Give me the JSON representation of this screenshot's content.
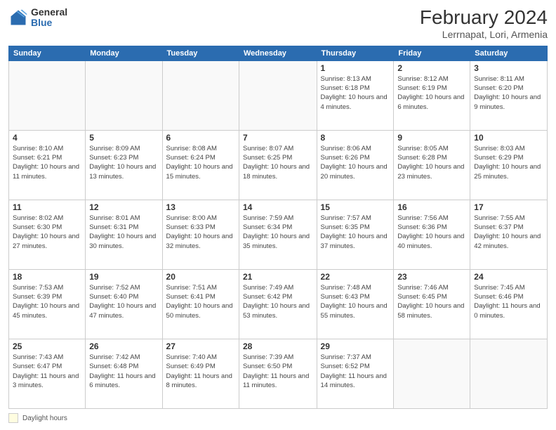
{
  "header": {
    "logo_general": "General",
    "logo_blue": "Blue",
    "title": "February 2024",
    "subtitle": "Lerrnapat, Lori, Armenia"
  },
  "footer": {
    "daylight_label": "Daylight hours"
  },
  "days_of_week": [
    "Sunday",
    "Monday",
    "Tuesday",
    "Wednesday",
    "Thursday",
    "Friday",
    "Saturday"
  ],
  "weeks": [
    [
      {
        "num": "",
        "info": ""
      },
      {
        "num": "",
        "info": ""
      },
      {
        "num": "",
        "info": ""
      },
      {
        "num": "",
        "info": ""
      },
      {
        "num": "1",
        "info": "Sunrise: 8:13 AM\nSunset: 6:18 PM\nDaylight: 10 hours\nand 4 minutes."
      },
      {
        "num": "2",
        "info": "Sunrise: 8:12 AM\nSunset: 6:19 PM\nDaylight: 10 hours\nand 6 minutes."
      },
      {
        "num": "3",
        "info": "Sunrise: 8:11 AM\nSunset: 6:20 PM\nDaylight: 10 hours\nand 9 minutes."
      }
    ],
    [
      {
        "num": "4",
        "info": "Sunrise: 8:10 AM\nSunset: 6:21 PM\nDaylight: 10 hours\nand 11 minutes."
      },
      {
        "num": "5",
        "info": "Sunrise: 8:09 AM\nSunset: 6:23 PM\nDaylight: 10 hours\nand 13 minutes."
      },
      {
        "num": "6",
        "info": "Sunrise: 8:08 AM\nSunset: 6:24 PM\nDaylight: 10 hours\nand 15 minutes."
      },
      {
        "num": "7",
        "info": "Sunrise: 8:07 AM\nSunset: 6:25 PM\nDaylight: 10 hours\nand 18 minutes."
      },
      {
        "num": "8",
        "info": "Sunrise: 8:06 AM\nSunset: 6:26 PM\nDaylight: 10 hours\nand 20 minutes."
      },
      {
        "num": "9",
        "info": "Sunrise: 8:05 AM\nSunset: 6:28 PM\nDaylight: 10 hours\nand 23 minutes."
      },
      {
        "num": "10",
        "info": "Sunrise: 8:03 AM\nSunset: 6:29 PM\nDaylight: 10 hours\nand 25 minutes."
      }
    ],
    [
      {
        "num": "11",
        "info": "Sunrise: 8:02 AM\nSunset: 6:30 PM\nDaylight: 10 hours\nand 27 minutes."
      },
      {
        "num": "12",
        "info": "Sunrise: 8:01 AM\nSunset: 6:31 PM\nDaylight: 10 hours\nand 30 minutes."
      },
      {
        "num": "13",
        "info": "Sunrise: 8:00 AM\nSunset: 6:33 PM\nDaylight: 10 hours\nand 32 minutes."
      },
      {
        "num": "14",
        "info": "Sunrise: 7:59 AM\nSunset: 6:34 PM\nDaylight: 10 hours\nand 35 minutes."
      },
      {
        "num": "15",
        "info": "Sunrise: 7:57 AM\nSunset: 6:35 PM\nDaylight: 10 hours\nand 37 minutes."
      },
      {
        "num": "16",
        "info": "Sunrise: 7:56 AM\nSunset: 6:36 PM\nDaylight: 10 hours\nand 40 minutes."
      },
      {
        "num": "17",
        "info": "Sunrise: 7:55 AM\nSunset: 6:37 PM\nDaylight: 10 hours\nand 42 minutes."
      }
    ],
    [
      {
        "num": "18",
        "info": "Sunrise: 7:53 AM\nSunset: 6:39 PM\nDaylight: 10 hours\nand 45 minutes."
      },
      {
        "num": "19",
        "info": "Sunrise: 7:52 AM\nSunset: 6:40 PM\nDaylight: 10 hours\nand 47 minutes."
      },
      {
        "num": "20",
        "info": "Sunrise: 7:51 AM\nSunset: 6:41 PM\nDaylight: 10 hours\nand 50 minutes."
      },
      {
        "num": "21",
        "info": "Sunrise: 7:49 AM\nSunset: 6:42 PM\nDaylight: 10 hours\nand 53 minutes."
      },
      {
        "num": "22",
        "info": "Sunrise: 7:48 AM\nSunset: 6:43 PM\nDaylight: 10 hours\nand 55 minutes."
      },
      {
        "num": "23",
        "info": "Sunrise: 7:46 AM\nSunset: 6:45 PM\nDaylight: 10 hours\nand 58 minutes."
      },
      {
        "num": "24",
        "info": "Sunrise: 7:45 AM\nSunset: 6:46 PM\nDaylight: 11 hours\nand 0 minutes."
      }
    ],
    [
      {
        "num": "25",
        "info": "Sunrise: 7:43 AM\nSunset: 6:47 PM\nDaylight: 11 hours\nand 3 minutes."
      },
      {
        "num": "26",
        "info": "Sunrise: 7:42 AM\nSunset: 6:48 PM\nDaylight: 11 hours\nand 6 minutes."
      },
      {
        "num": "27",
        "info": "Sunrise: 7:40 AM\nSunset: 6:49 PM\nDaylight: 11 hours\nand 8 minutes."
      },
      {
        "num": "28",
        "info": "Sunrise: 7:39 AM\nSunset: 6:50 PM\nDaylight: 11 hours\nand 11 minutes."
      },
      {
        "num": "29",
        "info": "Sunrise: 7:37 AM\nSunset: 6:52 PM\nDaylight: 11 hours\nand 14 minutes."
      },
      {
        "num": "",
        "info": ""
      },
      {
        "num": "",
        "info": ""
      }
    ]
  ]
}
